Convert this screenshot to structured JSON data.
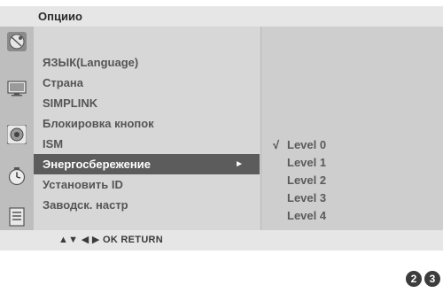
{
  "title": "Опциио",
  "menu": {
    "items": [
      {
        "label": "ЯЗЫК(Language)"
      },
      {
        "label": "Страна"
      },
      {
        "label": "SIMPLINK"
      },
      {
        "label": "Блокировка кнопок"
      },
      {
        "label": "ISM"
      },
      {
        "label": "Энергосбережение",
        "selected": true,
        "arrow": "►"
      },
      {
        "label": "Установить ID"
      },
      {
        "label": "Заводск. настр"
      }
    ]
  },
  "submenu": {
    "check_glyph": "√",
    "selected_index": 0,
    "items": [
      {
        "label": "Level 0"
      },
      {
        "label": "Level 1"
      },
      {
        "label": "Level 2"
      },
      {
        "label": "Level 3"
      },
      {
        "label": "Level 4"
      }
    ]
  },
  "footer": {
    "hint": "▲▼  ◀ ▶  OK  RETURN"
  },
  "steps": [
    "2",
    "3"
  ],
  "icons": [
    "satellite-dish-icon",
    "tv-screen-icon",
    "speaker-icon",
    "clock-icon",
    "option-list-icon"
  ],
  "colors": {
    "title_bar": "#e6e6e6",
    "icon_column": "#bebebe",
    "menu_panel": "#d7d7d7",
    "submenu_panel": "#cecece",
    "selected_row": "#5c5c5c",
    "menu_text": "#555555"
  }
}
